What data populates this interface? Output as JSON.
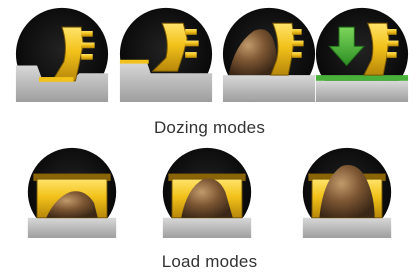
{
  "dozing_section": {
    "caption": "Dozing modes",
    "icons": [
      "blade-cut-mode-icon",
      "blade-carry-mode-icon",
      "blade-load-mode-icon",
      "blade-down-force-icon"
    ]
  },
  "load_section": {
    "caption": "Load modes",
    "icons": [
      "light-load-icon",
      "medium-load-icon",
      "heavy-load-icon"
    ]
  },
  "colors": {
    "blade_yellow": "#f2c21a",
    "icon_background": "#111111",
    "ground_gray": "#b9b9b9",
    "arrow_green": "#49b13a",
    "dirt_brown": "#6b4a2c"
  }
}
